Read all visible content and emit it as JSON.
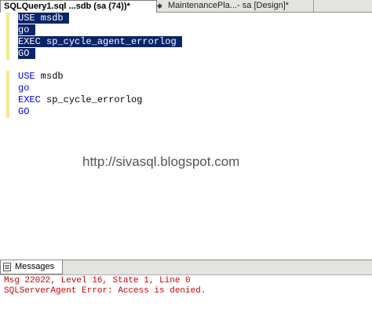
{
  "tabs": {
    "active_label": "SQLQuery1.sql ...sdb (sa (74))*",
    "separator": "◆",
    "inactive_label": "MaintenancePla...- sa [Design]*"
  },
  "editor": {
    "selected_block": {
      "line1_kw": "USE",
      "line1_rest": " msdb",
      "line2": "go",
      "line3_kw": "EXEC",
      "line3_rest": " sp_cycle_agent_errorlog",
      "line4": "GO"
    },
    "unselected_block": {
      "line1_kw": "USE",
      "line1_rest": " msdb",
      "line2": "go",
      "line3_kw": "EXEC",
      "line3_rest": " sp_cycle_errorlog",
      "line4": "GO"
    }
  },
  "watermark": "http://sivasql.blogspot.com",
  "results": {
    "tab_label": "Messages",
    "lines": [
      "Msg 22022, Level 16, State 1, Line 0",
      "SQLServerAgent Error: Access is denied."
    ]
  }
}
